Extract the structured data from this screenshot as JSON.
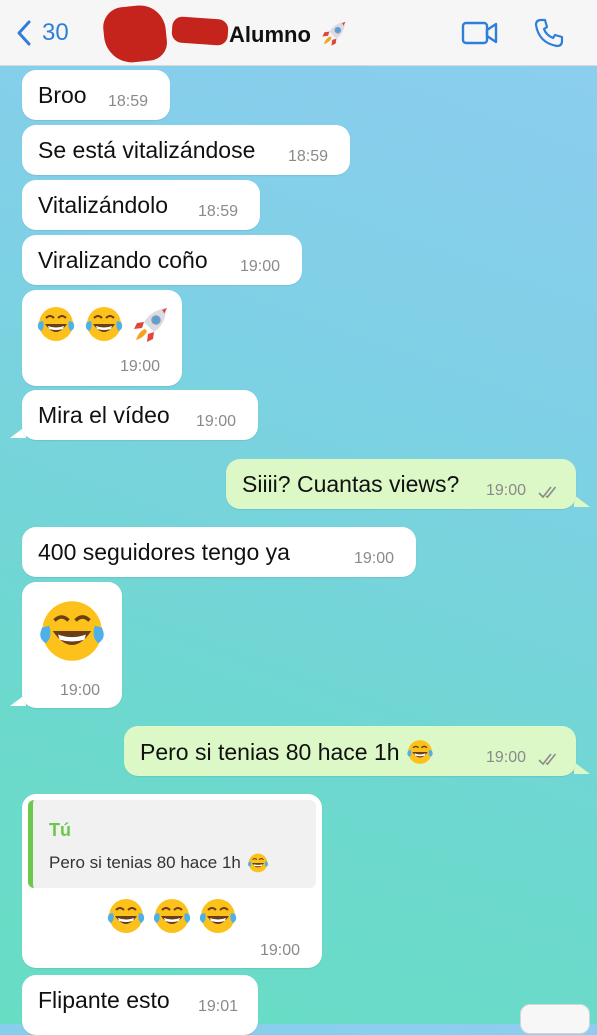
{
  "header": {
    "back_count": "30",
    "contact_name": "Alumno",
    "contact_emoji": "rocket"
  },
  "messages": [
    {
      "text": "Broo",
      "time": "18:59",
      "dir": "in"
    },
    {
      "text": "Se está vitalizándose",
      "time": "18:59",
      "dir": "in"
    },
    {
      "text": "Vitalizándolo",
      "time": "18:59",
      "dir": "in"
    },
    {
      "text": "Viralizando coño",
      "time": "19:00",
      "dir": "in"
    },
    {
      "emojis": [
        "laughing-tears",
        "laughing-tears",
        "rocket"
      ],
      "time": "19:00",
      "dir": "in"
    },
    {
      "text": "Mira el vídeo",
      "time": "19:00",
      "dir": "in"
    },
    {
      "text": "Siiii? Cuantas views?",
      "time": "19:00",
      "dir": "out",
      "status": "read"
    },
    {
      "text": "400 seguidores tengo ya",
      "time": "19:00",
      "dir": "in"
    },
    {
      "emojis": [
        "laughing-tears"
      ],
      "time": "19:00",
      "dir": "in"
    },
    {
      "text": "Pero si tenias 80 hace 1h",
      "emoji": "laughing-tears",
      "time": "19:00",
      "dir": "out",
      "status": "read"
    },
    {
      "quote": {
        "author": "Tú",
        "text": "Pero si tenias 80 hace 1h",
        "emoji": "laughing-tears"
      },
      "emojis": [
        "laughing-tears",
        "laughing-tears",
        "laughing-tears"
      ],
      "time": "19:00",
      "dir": "in"
    },
    {
      "text": "Flipante esto",
      "time": "19:01",
      "dir": "in"
    }
  ],
  "colors": {
    "accent": "#2f7fd8",
    "outgoing_bubble": "#dcf8c6",
    "incoming_bubble": "#ffffff",
    "quote_author": "#6cc84c"
  }
}
